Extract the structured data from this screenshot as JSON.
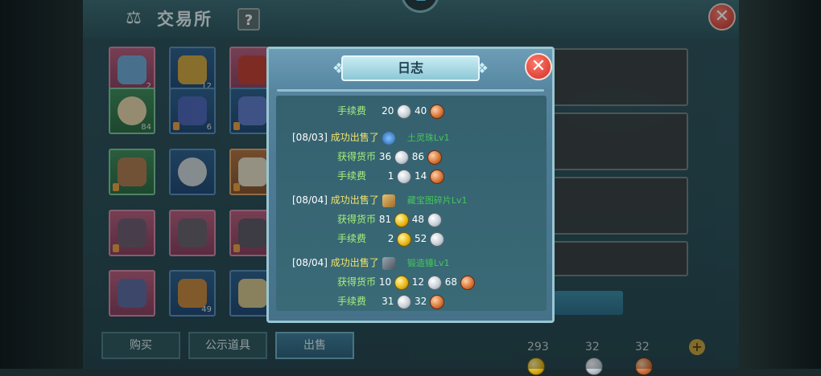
{
  "window": {
    "title": "交易所",
    "help_label": "?",
    "close_label": "✕"
  },
  "inventory": {
    "counts": [
      "2",
      "12",
      "",
      "84",
      "6",
      "",
      "",
      "",
      "",
      "",
      "",
      "",
      "",
      "49",
      ""
    ]
  },
  "bottom_tabs": [
    {
      "label": "购买",
      "active": false
    },
    {
      "label": "公示道具",
      "active": false
    },
    {
      "label": "出售",
      "active": true
    }
  ],
  "currency": {
    "gold": "293",
    "silver": "32",
    "copper": "32",
    "add_label": "+"
  },
  "log_dialog": {
    "title": "日志",
    "close_label": "✕",
    "fee_label": "手续费",
    "gain_label": "获得货币",
    "sold_label": "成功出售了",
    "top_fee": {
      "silver": "20",
      "copper": "40"
    },
    "entries": [
      {
        "date": "[08/03]",
        "item_name": "土灵珠Lv1",
        "item_color": "#45c65c",
        "gain": {
          "silver": "36",
          "copper": "86"
        },
        "fee": {
          "silver": "1",
          "copper": "14"
        }
      },
      {
        "date": "[08/04]",
        "item_name": "藏宝图碎片Lv1",
        "gain": {
          "gold": "81",
          "silver": "48"
        },
        "fee": {
          "gold": "2",
          "silver": "52"
        }
      },
      {
        "date": "[08/04]",
        "item_name": "锻造锤Lv1",
        "gain": {
          "gold": "10",
          "silver": "12",
          "copper": "68"
        },
        "fee": {
          "silver": "31",
          "copper": "32"
        }
      }
    ]
  },
  "colors": {
    "dialog_bg": "#4e7c96",
    "gold_coin": "#e8b918",
    "silver_coin": "#c7d1d8",
    "copper_coin": "#d9783d",
    "close_red": "#cf2e26"
  }
}
